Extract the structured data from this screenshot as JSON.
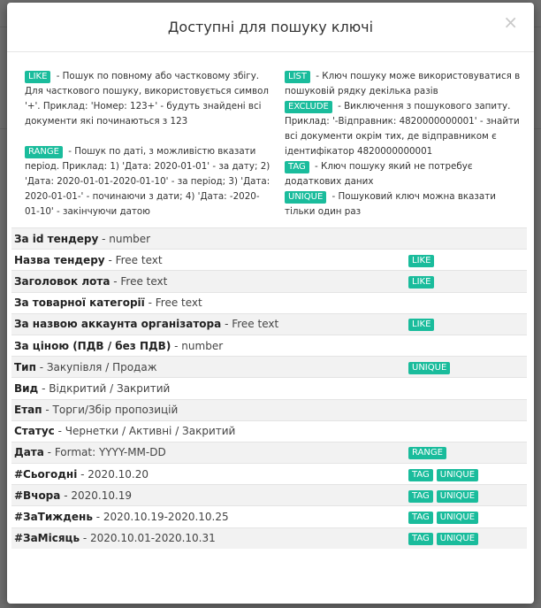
{
  "modal": {
    "title": "Доступні для пошуку ключі",
    "close_label": "×"
  },
  "legend": {
    "left": [
      {
        "badge": "LIKE",
        "text": "- Пошук по повному або частковому збігу. Для часткового пошуку, використовується символ '+'. Приклад: 'Номер: 123+' - будуть знайдені всі документи які починаються з 123"
      },
      {
        "badge": "RANGE",
        "text": "- Пошук по даті, з можливістю вказати період. Приклад: 1) 'Дата: 2020-01-01' - за дату; 2) 'Дата: 2020-01-01-2020-01-10' - за період; 3) 'Дата: 2020-01-01-' - починаючи з дати; 4) 'Дата: -2020-01-10' - закінчуючи датою"
      }
    ],
    "right": [
      {
        "badge": "LIST",
        "text": "- Ключ пошуку може використовуватися в пошуковій рядку декілька разів"
      },
      {
        "badge": "EXCLUDE",
        "text": "- Виключення з пошукового запиту. Приклад: '-Відправник: 4820000000001' - знайти всі документи окрім тих, де відправником є ідентифікатор 4820000000001"
      },
      {
        "badge": "TAG",
        "text": "- Ключ пошуку який не потребує додаткових даних"
      },
      {
        "badge": "UNIQUE",
        "text": "- Пошуковий ключ можна вказати тільки один раз"
      }
    ]
  },
  "keys": [
    {
      "name": "За id тендеру",
      "type": "- number",
      "badges": []
    },
    {
      "name": "Назва тендеру",
      "type": "- Free text",
      "badges": [
        "LIKE"
      ]
    },
    {
      "name": "Заголовок лота",
      "type": "- Free text",
      "badges": [
        "LIKE"
      ]
    },
    {
      "name": "За товарної категорії",
      "type": "- Free text",
      "badges": []
    },
    {
      "name": "За назвою аккаунта організатора",
      "type": "- Free text",
      "badges": [
        "LIKE"
      ]
    },
    {
      "name": "За ціною (ПДВ / без ПДВ)",
      "type": "- number",
      "badges": []
    },
    {
      "name": "Тип",
      "type": "- Закупівля / Продаж",
      "badges": [
        "UNIQUE"
      ]
    },
    {
      "name": "Вид",
      "type": "- Відкритий / Закритий",
      "badges": []
    },
    {
      "name": "Етап",
      "type": "- Торги/Збір пропозицій",
      "badges": []
    },
    {
      "name": "Статус",
      "type": "- Чернетки / Активні / Закритий",
      "badges": []
    },
    {
      "name": "Дата",
      "type": "- Format: YYYY-MM-DD",
      "badges": [
        "RANGE"
      ]
    },
    {
      "name": "#Сьогодні",
      "type": "- 2020.10.20",
      "badges": [
        "TAG",
        "UNIQUE"
      ]
    },
    {
      "name": "#Вчора",
      "type": "- 2020.10.19",
      "badges": [
        "TAG",
        "UNIQUE"
      ]
    },
    {
      "name": "#ЗаТиждень",
      "type": "- 2020.10.19-2020.10.25",
      "badges": [
        "TAG",
        "UNIQUE"
      ]
    },
    {
      "name": "#ЗаМісяць",
      "type": "- 2020.10.01-2020.10.31",
      "badges": [
        "TAG",
        "UNIQUE"
      ]
    }
  ],
  "colors": {
    "badge": "#1abc9c",
    "overlay": "rgba(0,0,0,0.55)"
  }
}
